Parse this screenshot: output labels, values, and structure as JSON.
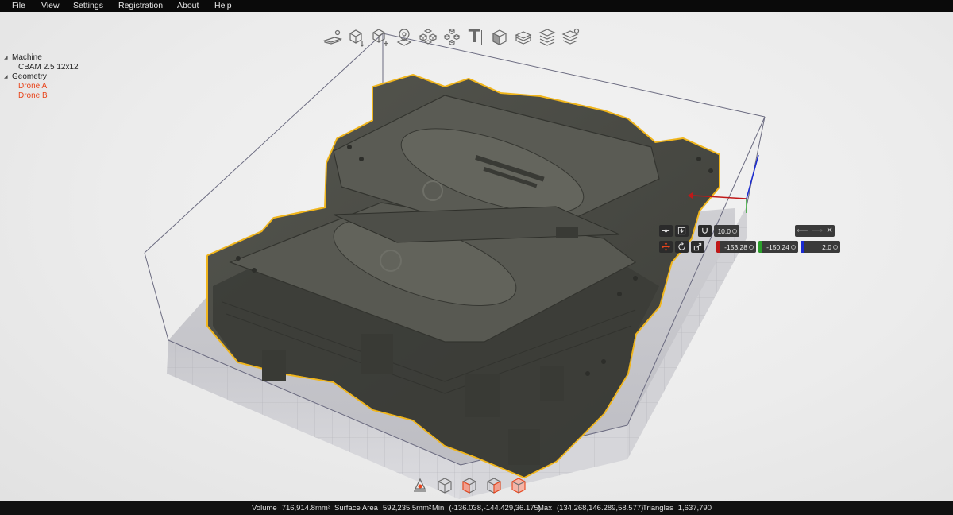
{
  "menu": {
    "items": [
      "File",
      "View",
      "Settings",
      "Registration",
      "About",
      "Help"
    ]
  },
  "toolbar": {
    "icons": [
      "build-plate-settings-icon",
      "add-part-icon",
      "move-part-icon",
      "pin-part-icon",
      "arrange-icon",
      "pack-icon",
      "text-icon",
      "cube-solid-icon",
      "layers-icon",
      "slice-stack-icon",
      "slice-settings-icon"
    ],
    "text_tool_label": "T"
  },
  "tree": {
    "machine_label": "Machine",
    "machine_name": "CBAM 2.5 12x12",
    "geometry_label": "Geometry",
    "parts": [
      "Drone A",
      "Drone B"
    ]
  },
  "gizmo": {
    "snap_value": "10.0",
    "x_value": "-153.28",
    "y_value": "-150.24",
    "z_value": "2.0",
    "axis_colors": {
      "x": "#c01818",
      "y": "#2aa02a",
      "z": "#1a2ad0"
    }
  },
  "viewbar": {
    "icons": [
      "view-orbit-icon",
      "view-iso-icon",
      "view-front-icon",
      "view-side-icon",
      "view-top-icon"
    ]
  },
  "status": {
    "volume_label": "Volume",
    "volume_value": "716,914.8mm³",
    "area_label": "Surface Area",
    "area_value": "592,235.5mm²",
    "min_label": "Min",
    "min_value": "(-136.038,-144.429,36.175)",
    "max_label": "Max",
    "max_value": "(134.268,146.289,58.577)",
    "triangles_label": "Triangles",
    "triangles_value": "1,637,790"
  },
  "colors": {
    "part": "#4a4b45",
    "selection_outline": "#f0b51c",
    "build_box": "#6b6b80",
    "accent_red": "#e8451c"
  }
}
